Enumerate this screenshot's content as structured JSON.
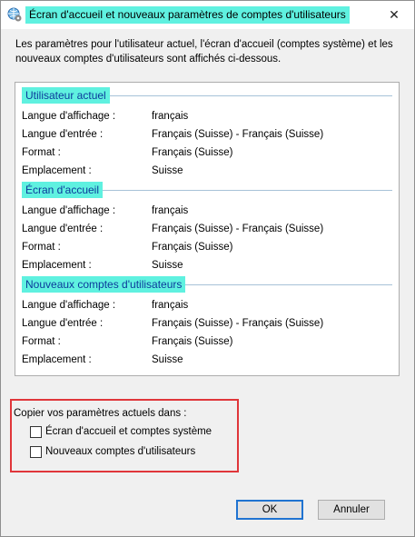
{
  "window": {
    "title": "Écran d'accueil et nouveaux paramètres de comptes d'utilisateurs",
    "icon": "globe-settings-icon",
    "close": "✕"
  },
  "intro": "Les paramètres pour l'utilisateur actuel, l'écran d'accueil (comptes système) et les nouveaux comptes d'utilisateurs sont affichés ci-dessous.",
  "sections": [
    {
      "title": "Utilisateur actuel",
      "rows": [
        {
          "key": "Langue d'affichage :",
          "value": "français"
        },
        {
          "key": "Langue d'entrée :",
          "value": "Français (Suisse) - Français (Suisse)"
        },
        {
          "key": "Format :",
          "value": "Français (Suisse)"
        },
        {
          "key": "Emplacement :",
          "value": "Suisse"
        }
      ]
    },
    {
      "title": "Écran d'accueil",
      "rows": [
        {
          "key": "Langue d'affichage :",
          "value": "français"
        },
        {
          "key": "Langue d'entrée :",
          "value": "Français (Suisse) - Français (Suisse)"
        },
        {
          "key": "Format :",
          "value": "Français (Suisse)"
        },
        {
          "key": "Emplacement :",
          "value": "Suisse"
        }
      ]
    },
    {
      "title": "Nouveaux comptes d'utilisateurs",
      "rows": [
        {
          "key": "Langue d'affichage :",
          "value": "français"
        },
        {
          "key": "Langue d'entrée :",
          "value": "Français (Suisse) - Français (Suisse)"
        },
        {
          "key": "Format :",
          "value": "Français (Suisse)"
        },
        {
          "key": "Emplacement :",
          "value": "Suisse"
        }
      ]
    }
  ],
  "copy": {
    "title": "Copier vos paramètres actuels dans :",
    "options": [
      {
        "label": "Écran d'accueil et comptes système",
        "checked": false
      },
      {
        "label": "Nouveaux comptes d'utilisateurs",
        "checked": false
      }
    ]
  },
  "buttons": {
    "ok": "OK",
    "cancel": "Annuler"
  },
  "colors": {
    "highlight": "#5ff1e0",
    "section_title": "#0b3a9b",
    "annotation_box": "#e0363a",
    "default_button_border": "#1f73d1"
  }
}
